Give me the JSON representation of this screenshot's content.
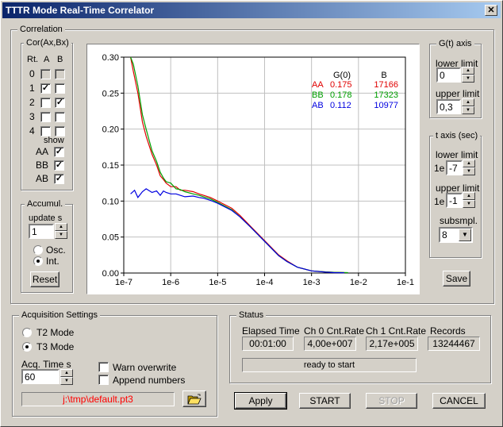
{
  "window": {
    "title": "TTTR Mode Real-Time Correlator",
    "close_label": "✕"
  },
  "correlation": {
    "group_label": "Correlation",
    "cor_group_label": "Cor(Ax,Bx)",
    "col_headers": [
      "Rt.",
      "A",
      "B"
    ],
    "routes": [
      {
        "rt": "0",
        "a": false,
        "b": false,
        "disabled": true
      },
      {
        "rt": "1",
        "a": true,
        "b": false,
        "disabled": false
      },
      {
        "rt": "2",
        "a": false,
        "b": true,
        "disabled": false
      },
      {
        "rt": "3",
        "a": false,
        "b": false,
        "disabled": false
      },
      {
        "rt": "4",
        "a": false,
        "b": false,
        "disabled": false
      }
    ],
    "show_label": "show",
    "show": [
      {
        "label": "AA",
        "checked": true
      },
      {
        "label": "BB",
        "checked": true
      },
      {
        "label": "AB",
        "checked": true
      }
    ]
  },
  "accumul": {
    "group_label": "Accumul.",
    "update_label": "update  s",
    "update_value": "1",
    "osc_label": "Osc.",
    "int_label": "Int.",
    "selected": "Int.",
    "reset_label": "Reset"
  },
  "gt_axis": {
    "group_label": "G(t) axis",
    "lower_label": "lower limit",
    "lower_value": "0",
    "upper_label": "upper limit",
    "upper_value": "0,3"
  },
  "t_axis": {
    "group_label": "t axis (sec)",
    "lower_label": "lower limit",
    "prefix": "1e",
    "lower_value": "-7",
    "upper_label": "upper limit",
    "upper_value": "-1",
    "subsmpl_label": "subsmpl.",
    "subsmpl_value": "8"
  },
  "save_label": "Save",
  "acquisition": {
    "group_label": "Acquisition Settings",
    "t2_label": "T2 Mode",
    "t3_label": "T3 Mode",
    "selected_mode": "T3 Mode",
    "acq_time_label": "Acq. Time  s",
    "acq_time_value": "60",
    "warn_overwrite_label": "Warn overwrite",
    "warn_overwrite": false,
    "append_numbers_label": "Append numbers",
    "append_numbers": false,
    "file_path": "j:\\tmp\\default.pt3",
    "file_path_color": "#ff0000",
    "browse_icon": "folder-open-icon"
  },
  "status": {
    "group_label": "Status",
    "fields": [
      {
        "label": "Elapsed Time",
        "value": "00:01:00"
      },
      {
        "label": "Ch 0  Cnt.Rate",
        "value": "4,00e+007"
      },
      {
        "label": "Ch 1  Cnt.Rate",
        "value": "2,17e+005"
      },
      {
        "label": "Records",
        "value": "13244467"
      }
    ],
    "message": "ready to start"
  },
  "buttons": {
    "apply": "Apply",
    "start": "START",
    "stop": "STOP",
    "cancel": "CANCEL"
  },
  "chart_data": {
    "type": "line",
    "xscale": "log",
    "xlim": [
      1e-07,
      0.1
    ],
    "ylim": [
      0,
      0.3
    ],
    "xticks": [
      "1e-7",
      "1e-6",
      "1e-5",
      "1e-4",
      "1e-3",
      "1e-2",
      "1e-1"
    ],
    "yticks": [
      "0.00",
      "0.05",
      "0.10",
      "0.15",
      "0.20",
      "0.25",
      "0.30"
    ],
    "grid": true,
    "legend_table": {
      "headers": [
        "",
        "G(0)",
        "B"
      ],
      "rows": [
        {
          "name": "AA",
          "g0": "0.175",
          "b": "17166",
          "color": "#e00000"
        },
        {
          "name": "BB",
          "g0": "0.178",
          "b": "17323",
          "color": "#00a000"
        },
        {
          "name": "AB",
          "g0": "0.112",
          "b": "10977",
          "color": "#0000e0"
        }
      ]
    },
    "series": [
      {
        "name": "AA",
        "color": "#e00000",
        "x": [
          1.4e-07,
          1.6e-07,
          2e-07,
          2.5e-07,
          3e-07,
          4e-07,
          5e-07,
          6e-07,
          7e-07,
          8e-07,
          1e-06,
          1.3e-06,
          1.6e-06,
          2e-06,
          3e-06,
          4e-06,
          5e-06,
          7e-06,
          1e-05,
          2e-05,
          3e-05,
          5e-05,
          0.0001,
          0.0002,
          0.0003,
          0.0005,
          0.001,
          0.002,
          0.003,
          0.005
        ],
        "y": [
          0.3,
          0.28,
          0.25,
          0.21,
          0.19,
          0.165,
          0.15,
          0.135,
          0.13,
          0.125,
          0.12,
          0.12,
          0.115,
          0.115,
          0.113,
          0.11,
          0.108,
          0.105,
          0.1,
          0.09,
          0.08,
          0.065,
          0.045,
          0.025,
          0.017,
          0.008,
          0.003,
          0.0015,
          0.001,
          0.0005
        ]
      },
      {
        "name": "BB",
        "color": "#00a000",
        "x": [
          1.4e-07,
          1.6e-07,
          2e-07,
          2.5e-07,
          3e-07,
          4e-07,
          5e-07,
          6e-07,
          7e-07,
          8e-07,
          1e-06,
          1.3e-06,
          1.6e-06,
          2e-06,
          3e-06,
          4e-06,
          5e-06,
          7e-06,
          1e-05,
          2e-05,
          3e-05,
          5e-05,
          0.0001,
          0.0002,
          0.0003,
          0.0005,
          0.001,
          0.002,
          0.003,
          0.006
        ],
        "y": [
          0.3,
          0.29,
          0.26,
          0.22,
          0.2,
          0.17,
          0.155,
          0.14,
          0.132,
          0.127,
          0.125,
          0.117,
          0.116,
          0.113,
          0.11,
          0.108,
          0.106,
          0.103,
          0.098,
          0.088,
          0.078,
          0.064,
          0.044,
          0.024,
          0.016,
          0.008,
          0.003,
          0.0015,
          0.001,
          0.0005
        ]
      },
      {
        "name": "AB",
        "color": "#0000e0",
        "x": [
          1.4e-07,
          1.7e-07,
          2e-07,
          2.5e-07,
          3e-07,
          4e-07,
          5e-07,
          6e-07,
          7e-07,
          8e-07,
          1e-06,
          1.3e-06,
          1.6e-06,
          2e-06,
          3e-06,
          4e-06,
          5e-06,
          7e-06,
          1e-05,
          2e-05,
          3e-05,
          5e-05,
          0.0001,
          0.0002,
          0.0003,
          0.0005,
          0.001,
          0.002,
          0.003,
          0.005
        ],
        "y": [
          0.11,
          0.115,
          0.105,
          0.113,
          0.117,
          0.112,
          0.114,
          0.108,
          0.114,
          0.112,
          0.11,
          0.11,
          0.108,
          0.106,
          0.107,
          0.105,
          0.104,
          0.101,
          0.097,
          0.087,
          0.078,
          0.064,
          0.044,
          0.024,
          0.016,
          0.008,
          0.003,
          0.0012,
          0.0005,
          0.0003
        ]
      }
    ]
  }
}
